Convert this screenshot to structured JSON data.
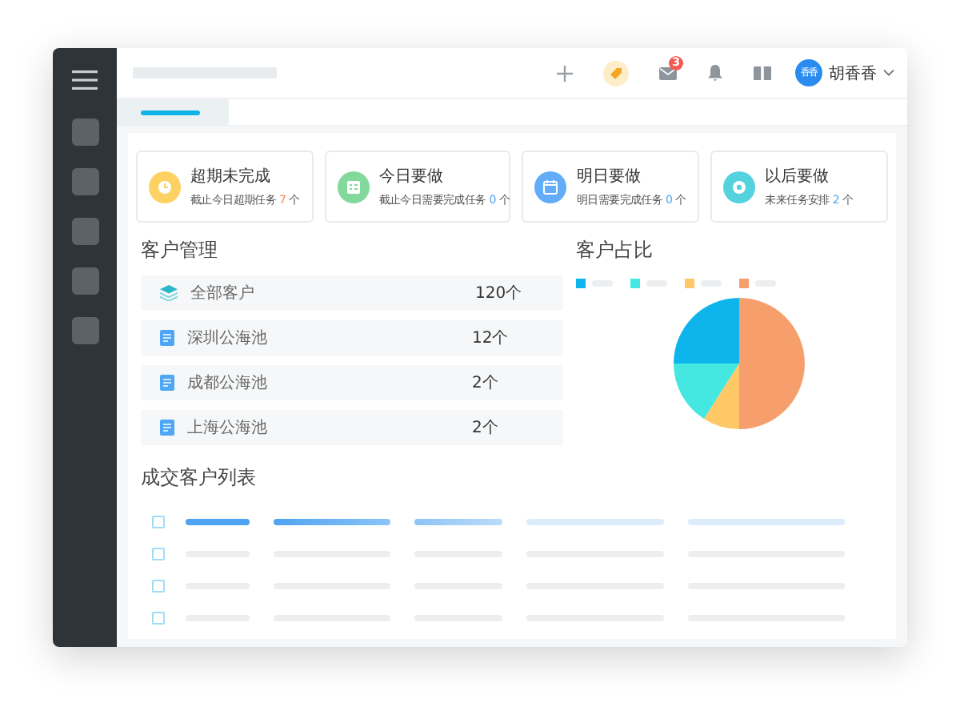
{
  "header": {
    "mail_badge": "3",
    "avatar": "香香",
    "user_name": "胡香香"
  },
  "tabs": [
    {
      "selected": true
    }
  ],
  "task_cards": [
    {
      "kind": "overdue",
      "color": "#fdd162",
      "title": "超期未完成",
      "note": "截止今日超期任务",
      "count": {
        "text": "7",
        "color": "#f5874f"
      },
      "unit": "个"
    },
    {
      "kind": "today",
      "color": "#83d99b",
      "title": "今日要做",
      "note": "截止今日需要完成任务",
      "count": {
        "text": "0",
        "color": "#4ea6f5"
      },
      "unit": "个"
    },
    {
      "kind": "tomorrow",
      "color": "#63acf7",
      "title": "明日要做",
      "note": "明日需要完成任务",
      "count": {
        "text": "0",
        "color": "#4ea6f5"
      },
      "unit": "个"
    },
    {
      "kind": "later",
      "color": "#54d3df",
      "title": "以后要做",
      "note": "未来任务安排",
      "count": {
        "text": "2",
        "color": "#4ea6f5"
      },
      "unit": "个"
    }
  ],
  "customer_management": {
    "title": "客户管理",
    "rows": [
      {
        "kind": "all",
        "label": "全部客户",
        "count": "120个"
      },
      {
        "kind": "pool",
        "label": "深圳公海池",
        "count": "12个"
      },
      {
        "kind": "pool",
        "label": "成都公海池",
        "count": "2个"
      },
      {
        "kind": "pool",
        "label": "上海公海池",
        "count": "2个"
      }
    ]
  },
  "customer_share": {
    "title": "客户占比",
    "legend": [
      {
        "color": "#0db5ec"
      },
      {
        "color": "#45e8e0"
      },
      {
        "color": "#fdc865"
      },
      {
        "color": "#f69f6c"
      }
    ]
  },
  "deal_list": {
    "title": "成交客户列表",
    "rows": [
      {
        "kind": "header",
        "checked": false
      },
      {
        "kind": "row",
        "checked": false
      },
      {
        "kind": "row",
        "checked": false
      },
      {
        "kind": "row",
        "checked": false
      }
    ]
  }
}
